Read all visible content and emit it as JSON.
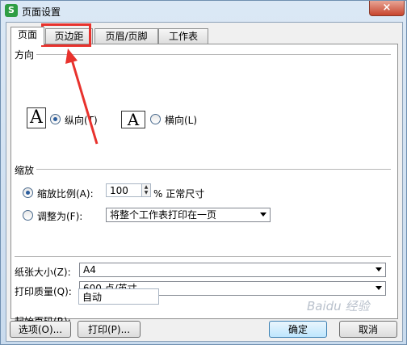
{
  "window": {
    "title": "页面设置",
    "close": "×",
    "app_icon": "S"
  },
  "tabs": [
    {
      "label": "页面",
      "active": true
    },
    {
      "label": "页边距",
      "active": false
    },
    {
      "label": "页眉/页脚",
      "active": false
    },
    {
      "label": "工作表",
      "active": false
    }
  ],
  "orientation": {
    "section": "方向",
    "icon_glyph": "A",
    "portrait": "纵向(T)",
    "landscape": "横向(L)",
    "selected": "portrait"
  },
  "scaling": {
    "section": "缩放",
    "ratio_label": "缩放比例(A):",
    "ratio_value": "100",
    "ratio_suffix": "% 正常尺寸",
    "fit_label": "调整为(F):",
    "fit_option": "将整个工作表打印在一页",
    "selected": "ratio"
  },
  "paper": {
    "size_label": "纸张大小(Z):",
    "size_value": "A4",
    "quality_label": "打印质量(Q):",
    "quality_value": "600 点/英寸",
    "start_label": "起始页码(R):",
    "start_value": "自动"
  },
  "buttons": {
    "options": "选项(O)...",
    "print": "打印(P)...",
    "ok": "确定",
    "cancel": "取消"
  },
  "watermark": "Baidu 经验",
  "colors": {
    "highlight": "#e8322d",
    "accent": "#2c5e9e"
  }
}
